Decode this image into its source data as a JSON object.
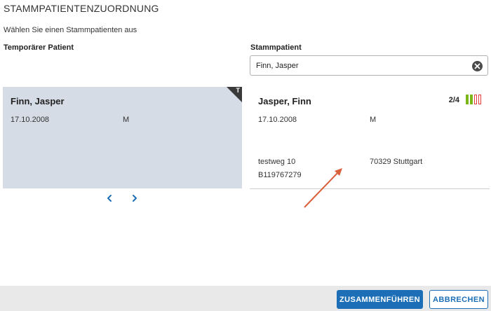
{
  "dialog": {
    "title": "STAMMPATIENTENZUORDNUNG",
    "subtitle": "Wählen Sie einen Stammpatienten aus"
  },
  "temporary": {
    "label": "Temporärer Patient",
    "badge": "T",
    "name": "Finn, Jasper",
    "birthdate": "17.10.2008",
    "gender": "M"
  },
  "master": {
    "label": "Stammpatient",
    "search_value": "Finn, Jasper",
    "name": "Jasper, Finn",
    "birthdate": "17.10.2008",
    "gender": "M",
    "street": "testweg 10",
    "city": "70329 Stuttgart",
    "insurance_id": "B119767279",
    "match_score": "2/4",
    "match_level": 0.5,
    "match_colors": {
      "match": "#7cb518",
      "nomatch": "#e03b3b"
    }
  },
  "footer": {
    "merge_label": "ZUSAMMENFÜHREN",
    "cancel_label": "ABBRECHEN"
  },
  "colors": {
    "accent": "#1c6fb6",
    "card_bg": "#d5dce6",
    "annotation_arrow": "#d9603b"
  }
}
